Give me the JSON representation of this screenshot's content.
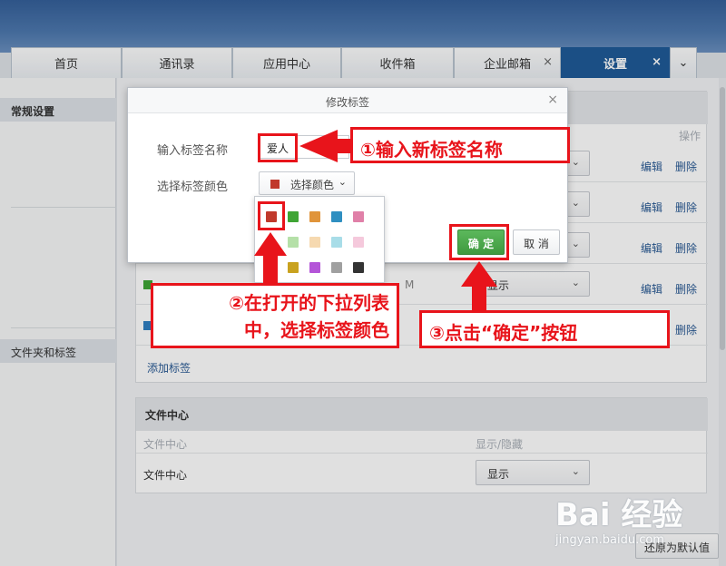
{
  "tabs": [
    {
      "label": "首页"
    },
    {
      "label": "通讯录"
    },
    {
      "label": "应用中心"
    },
    {
      "label": "收件箱"
    },
    {
      "label": "企业邮箱",
      "close": "×"
    },
    {
      "label": "设置",
      "close": "×"
    },
    {
      "label": "⌄"
    }
  ],
  "sidebar": {
    "general": "常规设置",
    "folders": "文件夹和标签"
  },
  "content": {
    "op_header": "操作",
    "edit": "编辑",
    "delete": "删除",
    "show": "显示",
    "m_text": "M",
    "add_tag": "添加标签",
    "file_center_title": "文件中心",
    "col_name": "文件中心",
    "col_visibility": "显示/隐藏",
    "file_center_row": "文件中心",
    "reset": "还原为默认值",
    "tag_colors": [
      "#3fa535",
      "#2f7fc1"
    ]
  },
  "modal": {
    "title": "修改标签",
    "close": "×",
    "name_label": "输入标签名称",
    "name_value": "爱人",
    "color_label": "选择标签颜色",
    "color_button": "选择颜色",
    "selected_color": "#c0392b",
    "ok": "确 定",
    "cancel": "取 消"
  },
  "palette": {
    "colors": [
      "#c0392b",
      "#3fa535",
      "#e0943a",
      "#2f8fc1",
      "#e080a8",
      "#ffffff",
      "#b5e0a8",
      "#f6d9b0",
      "#a8dde8",
      "#f5c9dc",
      "#ffffff",
      "#c9a21f",
      "#b455d8",
      "#a0a0a0",
      "#333333"
    ]
  },
  "annotations": {
    "step1": "①输入新标签名称",
    "step2_line1": "②在打开的下拉列表",
    "step2_line2": "中，选择标签颜色",
    "step3": "③点击“确定”按钮"
  },
  "watermark": {
    "brand": "Bai 经验",
    "url": "jingyan.baidu.com"
  }
}
